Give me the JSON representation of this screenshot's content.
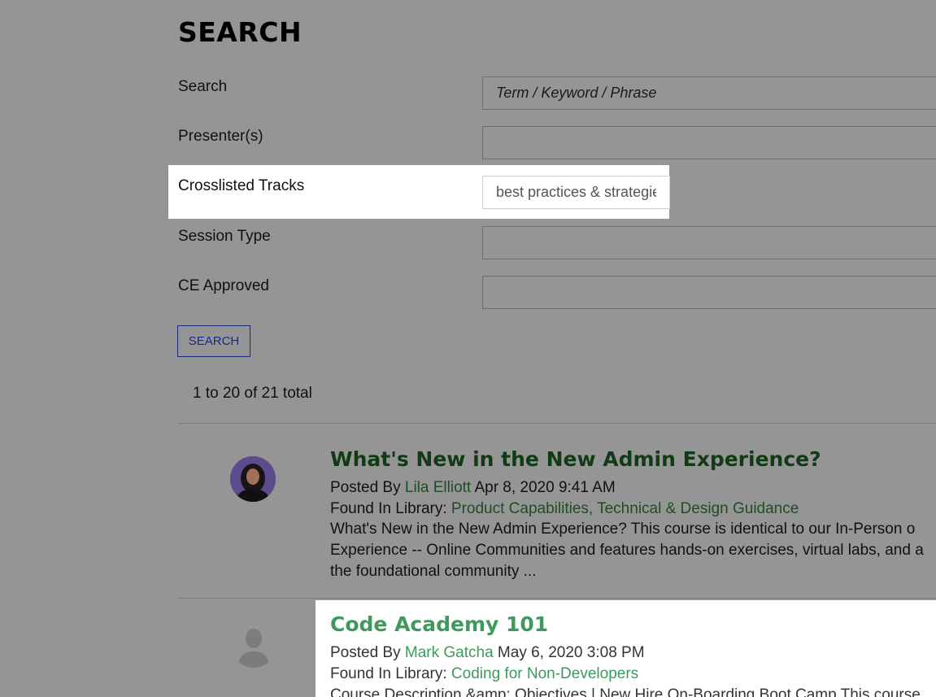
{
  "page": {
    "title": "SEARCH"
  },
  "form": {
    "search_label": "Search",
    "search_placeholder": "Term / Keyword / Phrase",
    "presenters_label": "Presenter(s)",
    "presenters_value": "",
    "tracks_label": "Crosslisted Tracks",
    "tracks_value": "best practices & strategies",
    "session_type_label": "Session Type",
    "session_type_value": "",
    "ce_label": "CE Approved",
    "ce_value": "",
    "submit_label": "SEARCH"
  },
  "results_summary": "1 to 20 of 21 total",
  "results": [
    {
      "title": "What's New in the New Admin Experience?",
      "posted_prefix": "Posted By ",
      "author": "Lila Elliott",
      "date": " Apr 8, 2020 9:41 AM",
      "library_prefix": "Found In Library: ",
      "library": "Product Capabilities, Technical & Design Guidance",
      "snippet": "What's New in the New Admin Experience? This course is identical to our In-Person o Experience -- Online Communities and features hands-on exercises, virtual labs, and a the foundational community ..."
    },
    {
      "title": "Code Academy 101",
      "posted_prefix": "Posted By ",
      "author": "Mark Gatcha",
      "date": " May 6, 2020 3:08 PM",
      "library_prefix": "Found In Library: ",
      "library": "Coding for Non-Developers",
      "snippet": "Course Description &amp; Objectives | New Hire On-Boarding Boot Camp This course"
    }
  ],
  "colors": {
    "accent_dark_green": "#1f4d22",
    "accent_green": "#3e9a5c",
    "button_blue": "#1c2a7a"
  }
}
